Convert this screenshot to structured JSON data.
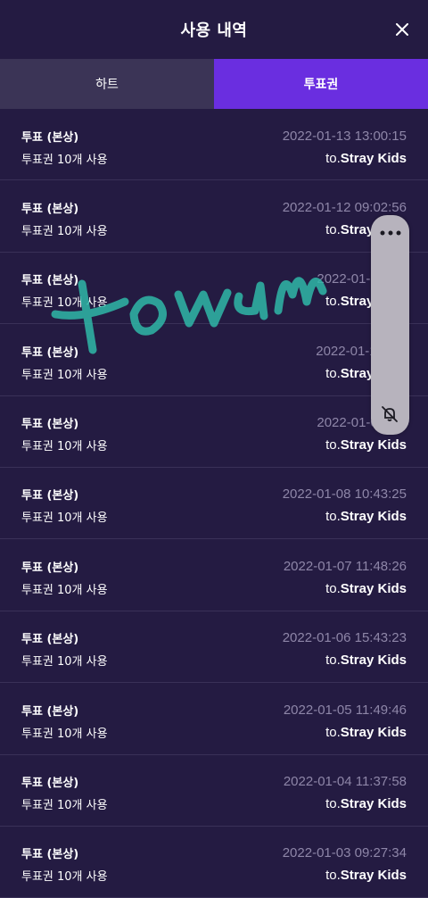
{
  "header": {
    "title": "사용 내역",
    "close_icon": "close-icon"
  },
  "tabs": [
    {
      "label": "하트",
      "active": false
    },
    {
      "label": "투표권",
      "active": true
    }
  ],
  "rows": [
    {
      "label": "투표 (본상)",
      "time": "2022-01-13 13:00:15",
      "usage": "투표권 10개 사용",
      "to": "to.",
      "artist": "Stray Kids"
    },
    {
      "label": "투표 (본상)",
      "time": "2022-01-12 09:02:56",
      "usage": "투표권 10개 사용",
      "to": "to.",
      "artist": "Stray Kids"
    },
    {
      "label": "투표 (본상)",
      "time": "2022-01-11 08:",
      "usage": "투표권 10개 사용",
      "to": "to.",
      "artist": "Stray Kids"
    },
    {
      "label": "투표 (본상)",
      "time": "2022-01-10 12:",
      "usage": "투표권 10개 사용",
      "to": "to.",
      "artist": "Stray Kids"
    },
    {
      "label": "투표 (본상)",
      "time": "2022-01-09 11:",
      "usage": "투표권 10개 사용",
      "to": "to.",
      "artist": "Stray Kids"
    },
    {
      "label": "투표 (본상)",
      "time": "2022-01-08 10:43:25",
      "usage": "투표권 10개 사용",
      "to": "to.",
      "artist": "Stray Kids"
    },
    {
      "label": "투표 (본상)",
      "time": "2022-01-07 11:48:26",
      "usage": "투표권 10개 사용",
      "to": "to.",
      "artist": "Stray Kids"
    },
    {
      "label": "투표 (본상)",
      "time": "2022-01-06 15:43:23",
      "usage": "투표권 10개 사용",
      "to": "to.",
      "artist": "Stray Kids"
    },
    {
      "label": "투표 (본상)",
      "time": "2022-01-05 11:49:46",
      "usage": "투표권 10개 사용",
      "to": "to.",
      "artist": "Stray Kids"
    },
    {
      "label": "투표 (본상)",
      "time": "2022-01-04 11:37:58",
      "usage": "투표권 10개 사용",
      "to": "to.",
      "artist": "Stray Kids"
    },
    {
      "label": "투표 (본상)",
      "time": "2022-01-03 09:27:34",
      "usage": "투표권 10개 사용",
      "to": "to.",
      "artist": "Stray Kids"
    }
  ],
  "floating_panel": {
    "more_icon": "more-horizontal-icon",
    "mute_icon": "bell-off-icon"
  },
  "colors": {
    "background": "#241b42",
    "active_tab": "#6a2ee0",
    "inactive_tab": "#3b3456",
    "timestamp": "#8e86a8",
    "watermark": "#2fb8a8"
  }
}
